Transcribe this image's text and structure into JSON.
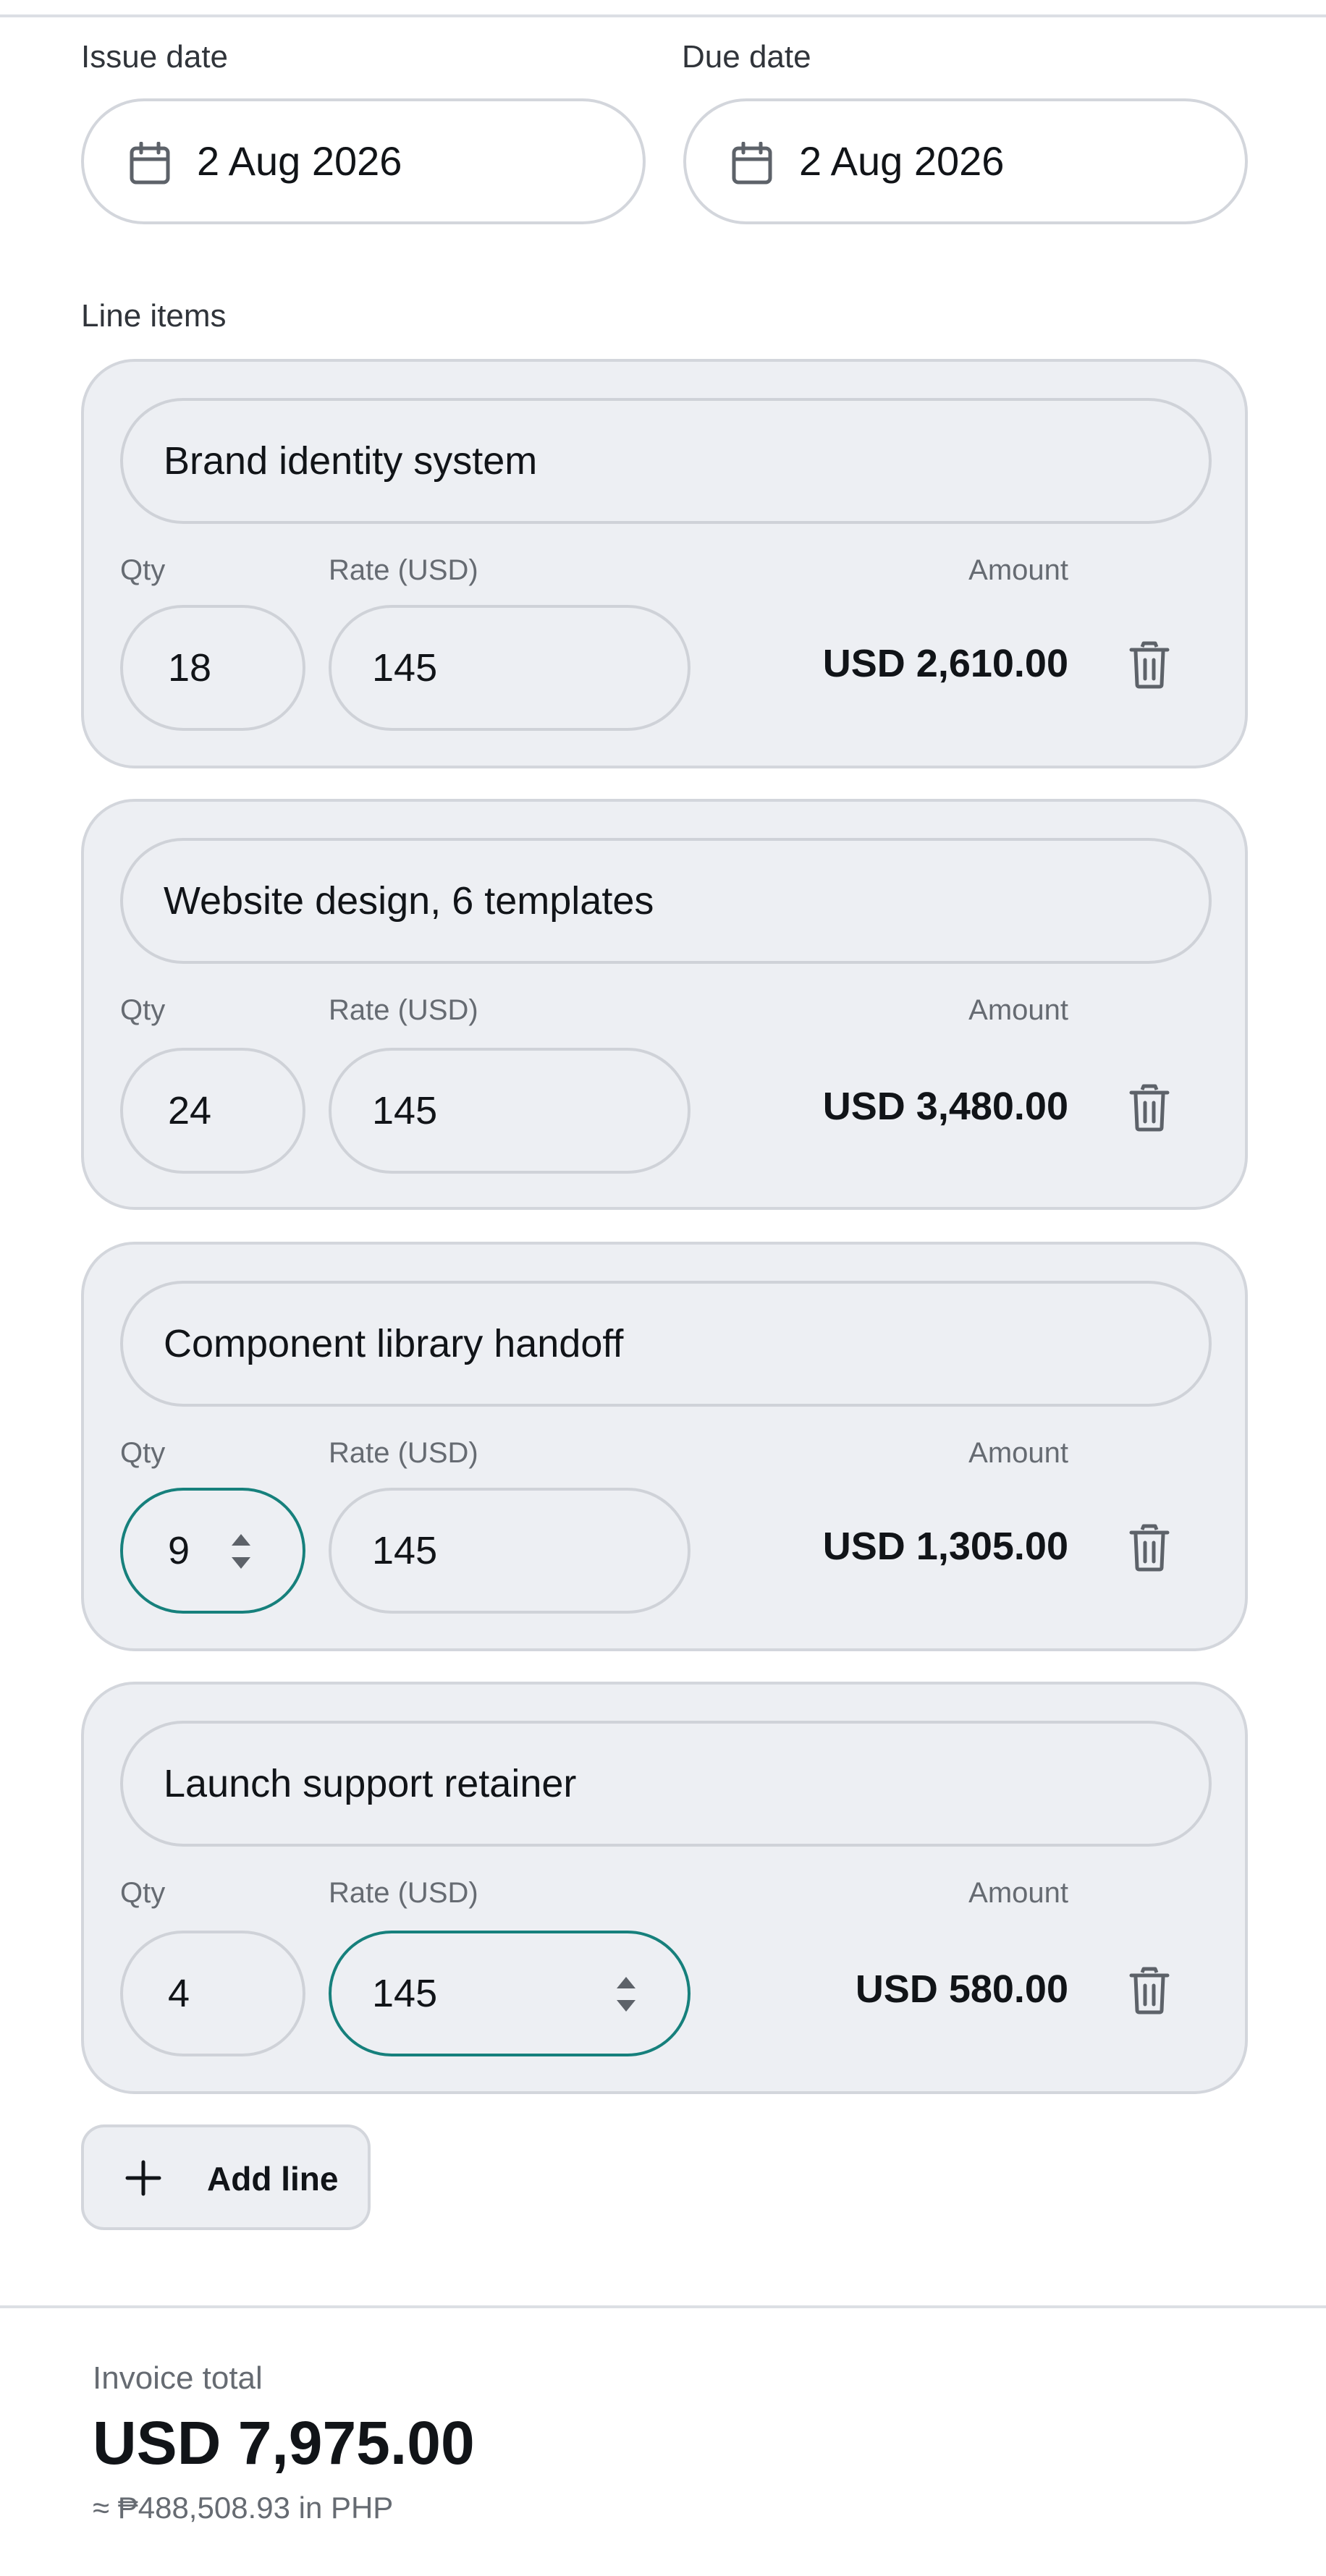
{
  "dates": {
    "issue_label": "Issue date",
    "issue_value": "2 Aug 2026",
    "due_label": "Due date",
    "due_value": "2 Aug 2026",
    "icon": "calendar-icon"
  },
  "line_items": {
    "section_label": "Line items",
    "qty_label": "Qty",
    "rate_label": "Rate (USD)",
    "amount_label": "Amount",
    "delete_icon": "trash-icon",
    "items": [
      {
        "description": "Brand identity system",
        "qty": "18",
        "rate": "145",
        "amount": "USD 2,610.00"
      },
      {
        "description": "Website design, 6 templates",
        "qty": "24",
        "rate": "145",
        "amount": "USD 3,480.00"
      },
      {
        "description": "Component library handoff",
        "qty": "9",
        "rate": "145",
        "amount": "USD 1,305.00"
      },
      {
        "description": "Launch support retainer",
        "qty": "4",
        "rate": "145",
        "amount": "USD 580.00"
      }
    ]
  },
  "add_line": {
    "label": "Add line",
    "icon": "plus-icon"
  },
  "totals": {
    "label": "Invoice total",
    "value": "USD 7,975.00",
    "converted": "≈ ₱488,508.93 in PHP"
  },
  "colors": {
    "accent": "#16807c",
    "card_bg": "#edeff3",
    "border": "#d3d6dc"
  }
}
